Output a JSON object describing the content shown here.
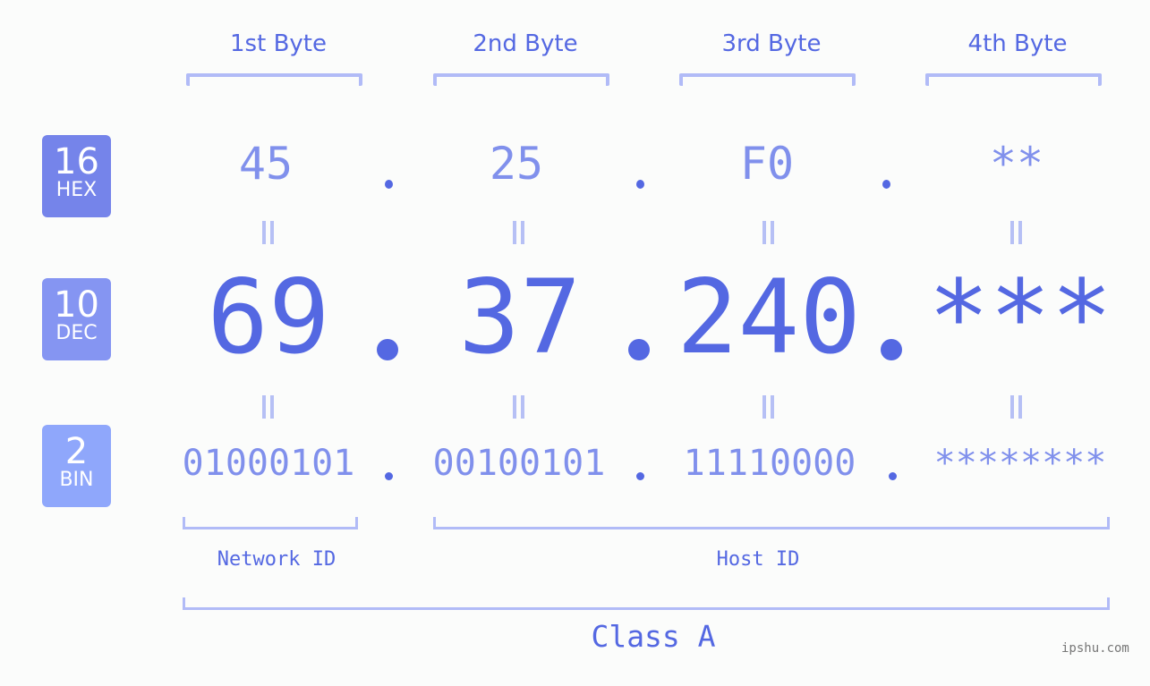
{
  "bytes": [
    {
      "label": "1st Byte",
      "hex": "45",
      "dec": "69",
      "bin": "01000101"
    },
    {
      "label": "2nd Byte",
      "hex": "25",
      "dec": "37",
      "bin": "00100101"
    },
    {
      "label": "3rd Byte",
      "hex": "F0",
      "dec": "240",
      "bin": "11110000"
    },
    {
      "label": "4th Byte",
      "hex": "**",
      "dec": "***",
      "bin": "********"
    }
  ],
  "badges": {
    "hex": {
      "num": "16",
      "label": "HEX",
      "color": "#7584ea"
    },
    "dec": {
      "num": "10",
      "label": "DEC",
      "color": "#8595f2"
    },
    "bin": {
      "num": "2",
      "label": "BIN",
      "color": "#8fa7fb"
    }
  },
  "network_label": "Network ID",
  "host_label": "Host ID",
  "class_label": "Class A",
  "watermark": "ipshu.com",
  "colors": {
    "accent": "#5468e2",
    "light": "#8090ec",
    "bracket": "#b1bbf7"
  }
}
